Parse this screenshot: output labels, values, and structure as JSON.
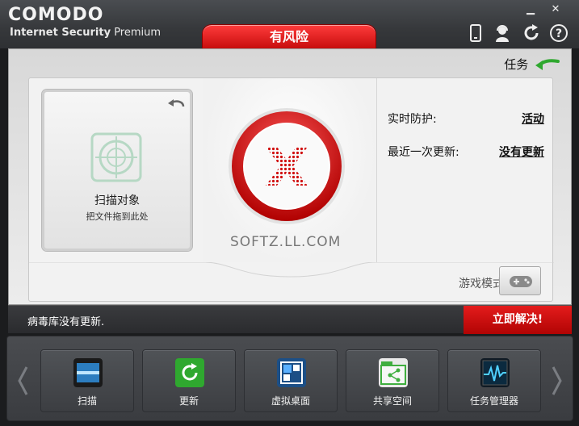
{
  "app": {
    "brand": "COMODO",
    "subtitle_bold": "Internet Security",
    "subtitle_rest": "Premium"
  },
  "status_tab": "有风险",
  "window_controls": {
    "minimize": "▁",
    "close": "✕"
  },
  "header_icons": [
    "mobile-icon",
    "support-icon",
    "refresh-icon",
    "help-icon"
  ],
  "main": {
    "tasks_label": "任务",
    "scan_card": {
      "title": "扫描对象",
      "subtitle": "把文件拖到此处"
    },
    "info": [
      {
        "label": "实时防护:",
        "value": "活动"
      },
      {
        "label": "最近一次更新:",
        "value": "没有更新"
      }
    ],
    "watermark": "SOFTZ.LL.COM",
    "game_mode_label": "游戏模式"
  },
  "status_bar": {
    "message": "病毒库没有更新.",
    "fix_label": "立即解决!"
  },
  "tiles": [
    {
      "label": "扫描",
      "icon": "scan-icon"
    },
    {
      "label": "更新",
      "icon": "update-icon"
    },
    {
      "label": "虚拟桌面",
      "icon": "virtual-desktop-icon"
    },
    {
      "label": "共享空间",
      "icon": "shared-space-icon"
    },
    {
      "label": "任务管理器",
      "icon": "task-manager-icon"
    }
  ],
  "colors": {
    "alert_red": "#d31010",
    "accent_green": "#2fa82f"
  }
}
